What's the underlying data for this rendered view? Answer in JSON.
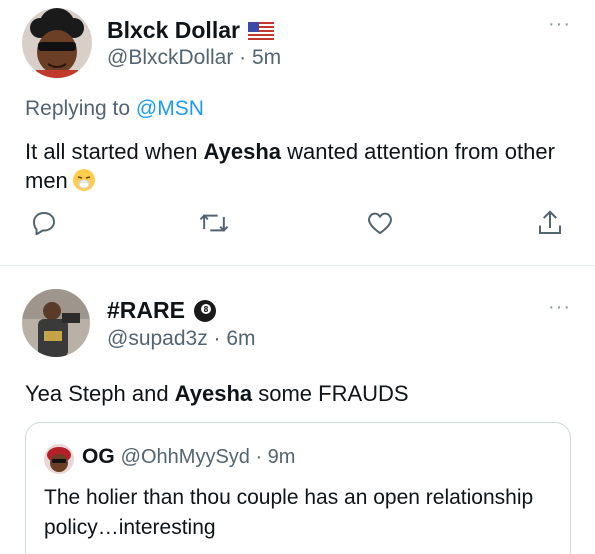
{
  "tweets": [
    {
      "display_name": "Blxck Dollar",
      "flag": "us-flag-icon",
      "handle_time": "@BlxckDollar · 5m",
      "more": "···",
      "replying_prefix": "Replying to ",
      "replying_mention": "@MSN",
      "text_before": "It all started when ",
      "text_bold": "Ayesha",
      "text_after": " wanted attention from other men",
      "emoji": "sneezing-face-icon",
      "actions": [
        "reply-icon",
        "retweet-icon",
        "like-icon",
        "share-icon"
      ]
    },
    {
      "display_name": "#RARE",
      "badge": "8-ball-icon",
      "handle_time": "@supad3z · 6m",
      "more": "···",
      "text_before": "Yea Steph and ",
      "text_bold": "Ayesha",
      "text_after": " some FRAUDS",
      "quote": {
        "name": "OG",
        "handle_time": "@OhhMyySyd · 9m",
        "text": "The holier than thou couple has an open relationship policy…interesting"
      }
    }
  ],
  "colors": {
    "link": "#1d9bf0",
    "secondary_text": "#536471",
    "primary_text": "#0f1419",
    "divider": "#e6ecf0"
  }
}
